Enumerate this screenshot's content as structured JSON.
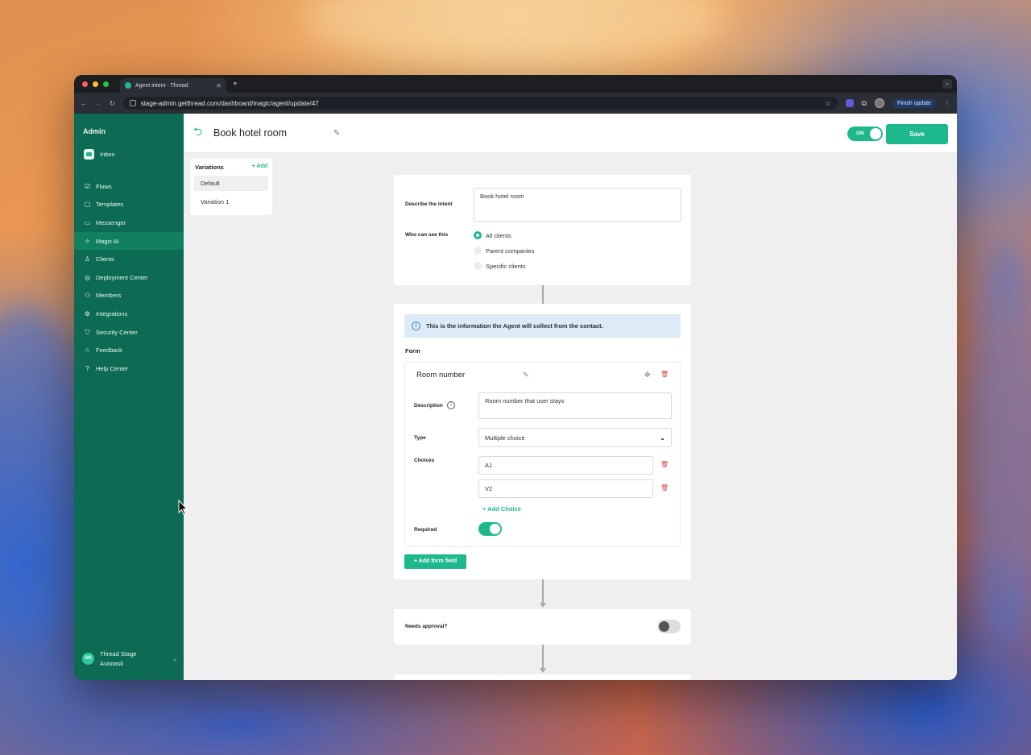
{
  "browser": {
    "tab_title": "Agent intent - Thread",
    "tab_close": "✕",
    "new_tab": "+",
    "url": "stage-admin.getthread.com/dashboard/magic/agent/update/47",
    "finish_update": "Finish update"
  },
  "sidebar": {
    "title": "Admin",
    "inbox_label": "Inbox",
    "items": [
      {
        "label": "Flows",
        "icon": "☑"
      },
      {
        "label": "Templates",
        "icon": "▢"
      },
      {
        "label": "Messenger",
        "icon": "▭"
      },
      {
        "label": "Magic AI",
        "icon": "✧"
      },
      {
        "label": "Clients",
        "icon": "♙"
      },
      {
        "label": "Deployment Center",
        "icon": "◎"
      },
      {
        "label": "Members",
        "icon": "⚇"
      },
      {
        "label": "Integrations",
        "icon": "⚙"
      },
      {
        "label": "Security Center",
        "icon": "⛉"
      },
      {
        "label": "Feedback",
        "icon": "☆"
      },
      {
        "label": "Help Center",
        "icon": "?"
      }
    ],
    "active_item": "Magic AI",
    "footer": {
      "initials": "AK",
      "line1": "Thread Stage",
      "line2": "Autotask"
    }
  },
  "header": {
    "title": "Book hotel room",
    "toggle_label": "ON",
    "save_label": "Save"
  },
  "variations": {
    "title": "Variations",
    "add_label": "+ Add",
    "items": [
      "Default",
      "Variation 1"
    ],
    "selected": "Default"
  },
  "intent_card": {
    "describe_label": "Describe the intent",
    "describe_value": "Book hotel room",
    "visibility_label": "Who can see this",
    "options": [
      "All clients",
      "Parent companies",
      "Specific clients"
    ],
    "selected_option": "All clients"
  },
  "form_card": {
    "info_text": "This is the information the Agent will collect from the contact.",
    "form_label": "Form",
    "field": {
      "name": "Room number",
      "description_label": "Description",
      "description_value": "Room number that user stays",
      "type_label": "Type",
      "type_value": "Multiple choice",
      "choices_label": "Choices",
      "choices": [
        "A1",
        "V2"
      ],
      "add_choice": "+ Add Choice",
      "required_label": "Required",
      "required": true
    },
    "add_field_label": "+ Add form field"
  },
  "approval_card": {
    "label": "Needs approval?",
    "enabled": false
  },
  "colors": {
    "sidebar": "#0c6b52",
    "accent": "#1db98d",
    "danger": "#e04848"
  }
}
